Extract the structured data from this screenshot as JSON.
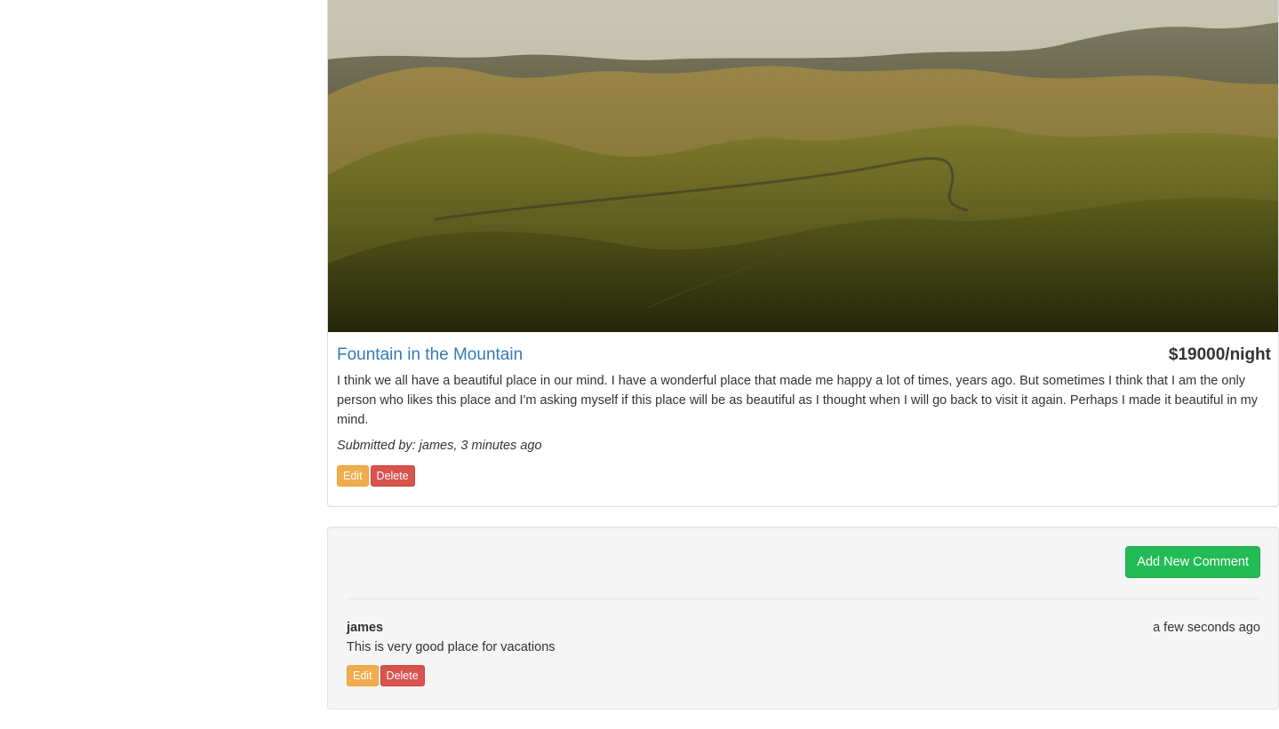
{
  "campground": {
    "image_alt": "Rolling hills landscape",
    "name": "Fountain in the Mountain",
    "price": "$19000/night",
    "description": "I think we all have a beautiful place in our mind. I have a wonderful place that made me happy a lot of times, years ago. But sometimes I think that I am the only person who likes this place and I'm asking myself if this place will be as beautiful as I thought when I will go back to visit it again. Perhaps I made it beautiful in my mind.",
    "submitted": "Submitted by: james, 3 minutes ago",
    "edit_label": "Edit",
    "delete_label": "Delete"
  },
  "comments_panel": {
    "add_label": "Add New Comment",
    "comments": [
      {
        "author": "james",
        "time": "a few seconds ago",
        "text": "This is very good place for vacations",
        "edit_label": "Edit",
        "delete_label": "Delete"
      }
    ]
  },
  "colors": {
    "link": "#337ab7",
    "warning": "#f0ad4e",
    "danger": "#d9534f",
    "success": "#22bb55"
  }
}
